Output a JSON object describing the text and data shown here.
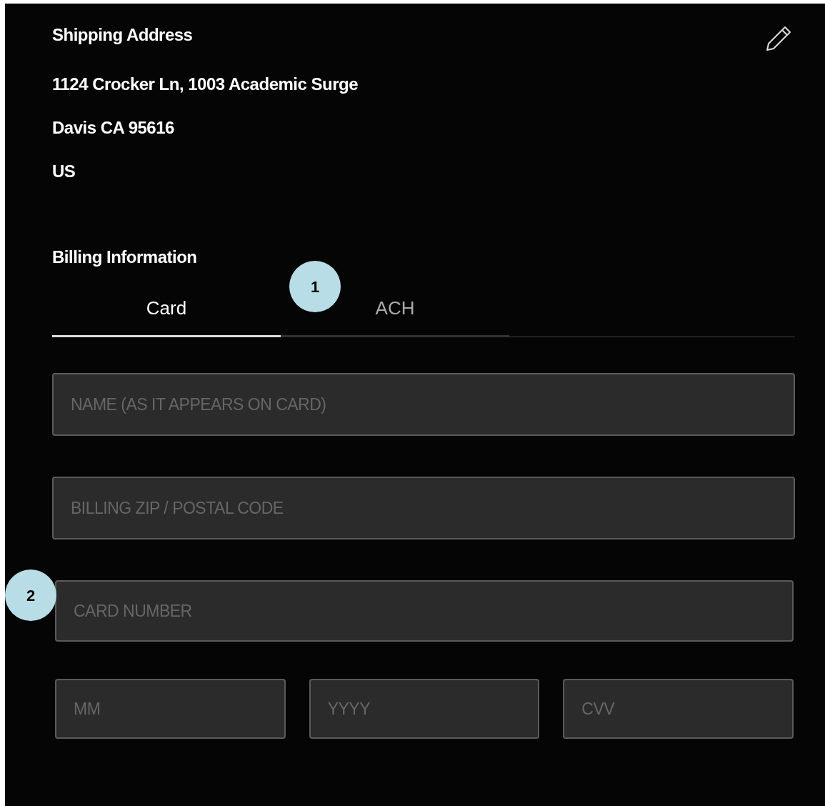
{
  "shipping": {
    "title": "Shipping Address",
    "lines": [
      "1124 Crocker Ln, 1003 Academic Surge",
      "Davis CA 95616",
      "US"
    ]
  },
  "billing": {
    "title": "Billing Information",
    "tabs": [
      {
        "label": "Card",
        "selected": true
      },
      {
        "label": "ACH",
        "selected": false
      }
    ],
    "fields": [
      {
        "placeholder": "NAME (AS IT APPEARS ON CARD)"
      },
      {
        "placeholder": "BILLING ZIP / POSTAL CODE"
      },
      {
        "placeholder": "CARD NUMBER"
      }
    ],
    "small_fields": [
      {
        "placeholder": "MM"
      },
      {
        "placeholder": "YYYY"
      },
      {
        "placeholder": "CVV"
      }
    ]
  },
  "callouts": [
    "1",
    "2"
  ]
}
